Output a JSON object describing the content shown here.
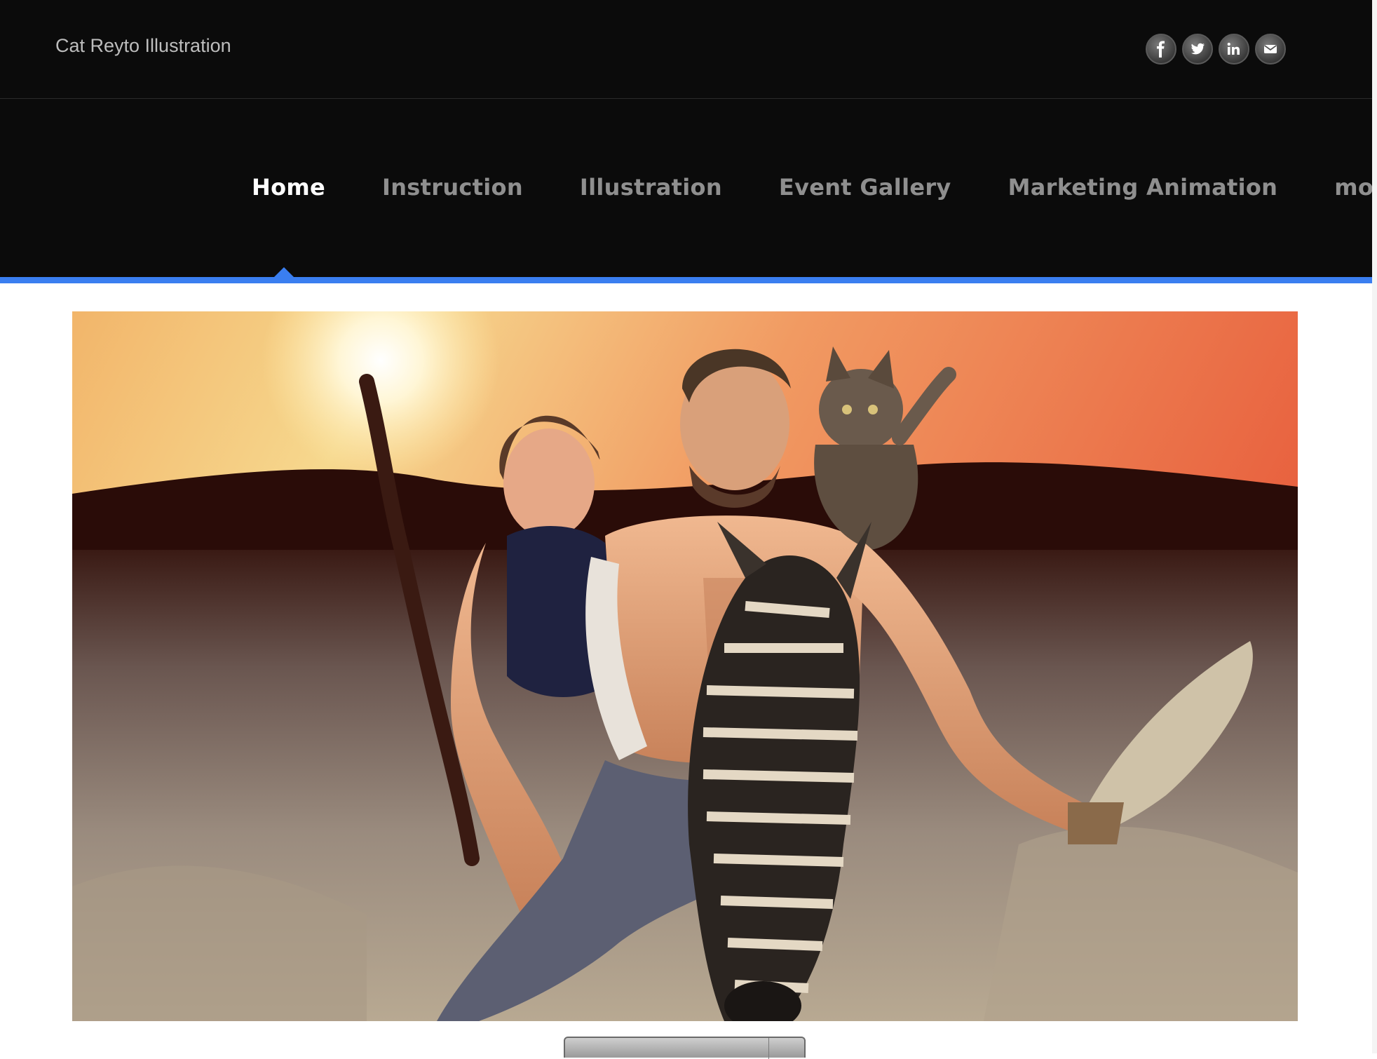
{
  "header": {
    "site_title": "Cat Reyto Illustration",
    "social": [
      {
        "icon": "facebook-icon"
      },
      {
        "icon": "twitter-icon"
      },
      {
        "icon": "linkedin-icon"
      },
      {
        "icon": "email-icon"
      }
    ]
  },
  "nav": {
    "items": [
      "Home",
      "Instruction",
      "Illustration",
      "Event Gallery",
      "Marketing Animation",
      "more..."
    ],
    "active": "Home",
    "accent_color": "#3a7ef0"
  },
  "hero": {
    "subject": "painted illustration: woman, shirtless man and cat riding a zebra across a desert at sunset"
  },
  "colors": {
    "header_bg": "#0b0b0b",
    "nav_text": "#8f8f8f",
    "nav_active_text": "#ffffff"
  }
}
